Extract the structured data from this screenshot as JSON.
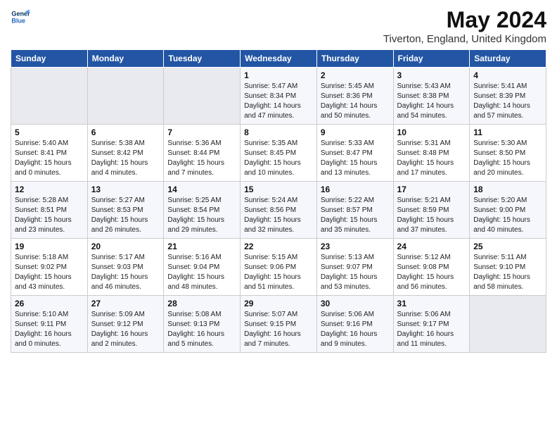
{
  "logo": {
    "line1": "General",
    "line2": "Blue"
  },
  "title": "May 2024",
  "subtitle": "Tiverton, England, United Kingdom",
  "headers": [
    "Sunday",
    "Monday",
    "Tuesday",
    "Wednesday",
    "Thursday",
    "Friday",
    "Saturday"
  ],
  "weeks": [
    [
      {
        "day": "",
        "empty": true
      },
      {
        "day": "",
        "empty": true
      },
      {
        "day": "",
        "empty": true
      },
      {
        "day": "1",
        "info": "Sunrise: 5:47 AM\nSunset: 8:34 PM\nDaylight: 14 hours\nand 47 minutes."
      },
      {
        "day": "2",
        "info": "Sunrise: 5:45 AM\nSunset: 8:36 PM\nDaylight: 14 hours\nand 50 minutes."
      },
      {
        "day": "3",
        "info": "Sunrise: 5:43 AM\nSunset: 8:38 PM\nDaylight: 14 hours\nand 54 minutes."
      },
      {
        "day": "4",
        "info": "Sunrise: 5:41 AM\nSunset: 8:39 PM\nDaylight: 14 hours\nand 57 minutes."
      }
    ],
    [
      {
        "day": "5",
        "info": "Sunrise: 5:40 AM\nSunset: 8:41 PM\nDaylight: 15 hours\nand 0 minutes."
      },
      {
        "day": "6",
        "info": "Sunrise: 5:38 AM\nSunset: 8:42 PM\nDaylight: 15 hours\nand 4 minutes."
      },
      {
        "day": "7",
        "info": "Sunrise: 5:36 AM\nSunset: 8:44 PM\nDaylight: 15 hours\nand 7 minutes."
      },
      {
        "day": "8",
        "info": "Sunrise: 5:35 AM\nSunset: 8:45 PM\nDaylight: 15 hours\nand 10 minutes."
      },
      {
        "day": "9",
        "info": "Sunrise: 5:33 AM\nSunset: 8:47 PM\nDaylight: 15 hours\nand 13 minutes."
      },
      {
        "day": "10",
        "info": "Sunrise: 5:31 AM\nSunset: 8:48 PM\nDaylight: 15 hours\nand 17 minutes."
      },
      {
        "day": "11",
        "info": "Sunrise: 5:30 AM\nSunset: 8:50 PM\nDaylight: 15 hours\nand 20 minutes."
      }
    ],
    [
      {
        "day": "12",
        "info": "Sunrise: 5:28 AM\nSunset: 8:51 PM\nDaylight: 15 hours\nand 23 minutes."
      },
      {
        "day": "13",
        "info": "Sunrise: 5:27 AM\nSunset: 8:53 PM\nDaylight: 15 hours\nand 26 minutes."
      },
      {
        "day": "14",
        "info": "Sunrise: 5:25 AM\nSunset: 8:54 PM\nDaylight: 15 hours\nand 29 minutes."
      },
      {
        "day": "15",
        "info": "Sunrise: 5:24 AM\nSunset: 8:56 PM\nDaylight: 15 hours\nand 32 minutes."
      },
      {
        "day": "16",
        "info": "Sunrise: 5:22 AM\nSunset: 8:57 PM\nDaylight: 15 hours\nand 35 minutes."
      },
      {
        "day": "17",
        "info": "Sunrise: 5:21 AM\nSunset: 8:59 PM\nDaylight: 15 hours\nand 37 minutes."
      },
      {
        "day": "18",
        "info": "Sunrise: 5:20 AM\nSunset: 9:00 PM\nDaylight: 15 hours\nand 40 minutes."
      }
    ],
    [
      {
        "day": "19",
        "info": "Sunrise: 5:18 AM\nSunset: 9:02 PM\nDaylight: 15 hours\nand 43 minutes."
      },
      {
        "day": "20",
        "info": "Sunrise: 5:17 AM\nSunset: 9:03 PM\nDaylight: 15 hours\nand 46 minutes."
      },
      {
        "day": "21",
        "info": "Sunrise: 5:16 AM\nSunset: 9:04 PM\nDaylight: 15 hours\nand 48 minutes."
      },
      {
        "day": "22",
        "info": "Sunrise: 5:15 AM\nSunset: 9:06 PM\nDaylight: 15 hours\nand 51 minutes."
      },
      {
        "day": "23",
        "info": "Sunrise: 5:13 AM\nSunset: 9:07 PM\nDaylight: 15 hours\nand 53 minutes."
      },
      {
        "day": "24",
        "info": "Sunrise: 5:12 AM\nSunset: 9:08 PM\nDaylight: 15 hours\nand 56 minutes."
      },
      {
        "day": "25",
        "info": "Sunrise: 5:11 AM\nSunset: 9:10 PM\nDaylight: 15 hours\nand 58 minutes."
      }
    ],
    [
      {
        "day": "26",
        "info": "Sunrise: 5:10 AM\nSunset: 9:11 PM\nDaylight: 16 hours\nand 0 minutes."
      },
      {
        "day": "27",
        "info": "Sunrise: 5:09 AM\nSunset: 9:12 PM\nDaylight: 16 hours\nand 2 minutes."
      },
      {
        "day": "28",
        "info": "Sunrise: 5:08 AM\nSunset: 9:13 PM\nDaylight: 16 hours\nand 5 minutes."
      },
      {
        "day": "29",
        "info": "Sunrise: 5:07 AM\nSunset: 9:15 PM\nDaylight: 16 hours\nand 7 minutes."
      },
      {
        "day": "30",
        "info": "Sunrise: 5:06 AM\nSunset: 9:16 PM\nDaylight: 16 hours\nand 9 minutes."
      },
      {
        "day": "31",
        "info": "Sunrise: 5:06 AM\nSunset: 9:17 PM\nDaylight: 16 hours\nand 11 minutes."
      },
      {
        "day": "",
        "empty": true
      }
    ]
  ]
}
